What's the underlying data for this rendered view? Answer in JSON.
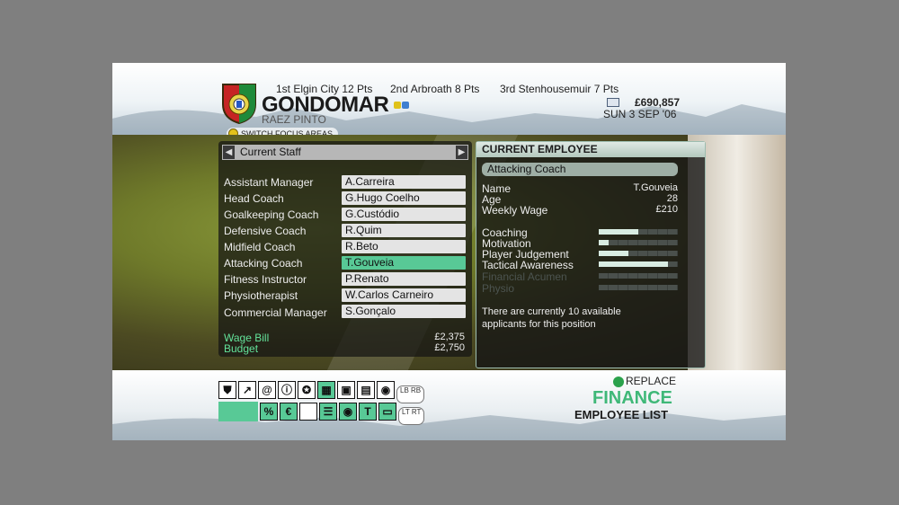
{
  "header": {
    "club_name": "GONDOMAR",
    "manager_name": "RAEZ PINTO",
    "league": [
      "1st Elgin City 12 Pts",
      "2nd Arbroath 8 Pts",
      "3rd Stenhousemuir 7 Pts"
    ],
    "money": "£690,857",
    "date": "SUN 3 SEP '06",
    "switch_focus": "SWITCH FOCUS AREAS",
    "crest_icon": "club-crest-icon",
    "mail_icon": "mail-icon",
    "club_colors": [
      "#e0c21a",
      "#3f7fd0"
    ]
  },
  "staff_panel": {
    "header": "Current Staff",
    "roles": [
      {
        "role": "Assistant Manager",
        "name": "A.Carreira"
      },
      {
        "role": "Head Coach",
        "name": "G.Hugo Coelho"
      },
      {
        "role": "Goalkeeping Coach",
        "name": "G.Custódio"
      },
      {
        "role": "Defensive Coach",
        "name": "R.Quim"
      },
      {
        "role": "Midfield Coach",
        "name": "R.Beto"
      },
      {
        "role": "Attacking Coach",
        "name": "T.Gouveia"
      },
      {
        "role": "Fitness Instructor",
        "name": "P.Renato"
      },
      {
        "role": "Physiotherapist",
        "name": "W.Carlos Carneiro"
      },
      {
        "role": "Commercial Manager",
        "name": "S.Gonçalo"
      }
    ],
    "selected_index": 5,
    "wage_bill_label": "Wage Bill",
    "wage_bill": "£2,375",
    "budget_label": "Budget",
    "budget": "£2,750"
  },
  "employee_panel": {
    "title": "CURRENT EMPLOYEE",
    "role": "Attacking Coach",
    "info": [
      {
        "label": "Name",
        "value": "T.Gouveia"
      },
      {
        "label": "Age",
        "value": "28"
      },
      {
        "label": "Weekly Wage",
        "value": "£210"
      }
    ],
    "attributes": [
      {
        "label": "Coaching",
        "level": 0.5,
        "dim": false
      },
      {
        "label": "Motivation",
        "level": 0.13,
        "dim": false
      },
      {
        "label": "Player Judgement",
        "level": 0.38,
        "dim": false
      },
      {
        "label": "Tactical Awareness",
        "level": 0.88,
        "dim": false
      },
      {
        "label": "Financial Acumen",
        "level": 0.0,
        "dim": true
      },
      {
        "label": "Physio",
        "level": 0.0,
        "dim": true
      }
    ],
    "note": "There are currently 10 available applicants for this position"
  },
  "footer": {
    "replace_label": "REPLACE",
    "section": "FINANCE",
    "subsection": "EMPLOYEE LIST",
    "row1_icons": [
      "shield-icon",
      "tactics-icon",
      "at-icon",
      "info-icon",
      "ball-icon",
      "calculator-icon",
      "notepad-icon",
      "clipboard-icon",
      "globe-icon"
    ],
    "row2_icons": [
      "percent-icon",
      "euro-icon",
      "staff-icon",
      "list-icon",
      "ball-icon",
      "shirt-icon",
      "ticket-icon"
    ],
    "lb": "LB",
    "rb": "RB",
    "lt": "LT",
    "rt": "RT"
  }
}
